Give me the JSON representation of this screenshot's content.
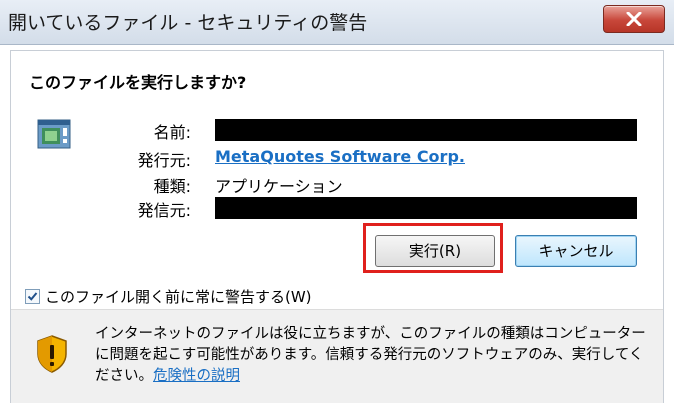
{
  "window": {
    "title": "開いているファイル - セキュリティの警告",
    "close_label": "X"
  },
  "dialog": {
    "question": "このファイルを実行しますか?",
    "fields": [
      {
        "label": "名前:",
        "value": ""
      },
      {
        "label": "発行元:",
        "value": "MetaQuotes Software Corp."
      },
      {
        "label": "種類:",
        "value": "アプリケーション"
      },
      {
        "label": "発信元:",
        "value": ""
      }
    ],
    "run_label": "実行(R)",
    "cancel_label": "キャンセル",
    "checkbox_label": "このファイル開く前に常に警告する(W)",
    "checkbox_checked": true,
    "warning_text": "インターネットのファイルは役に立ちますが、このファイルの種類はコンピューターに問題を起こす可能性があります。信頼する発行元のソフトウェアのみ、実行してください。",
    "risk_link": "危険性の説明"
  },
  "colors": {
    "link": "#1a6fc4",
    "highlight": "#e0201d"
  }
}
